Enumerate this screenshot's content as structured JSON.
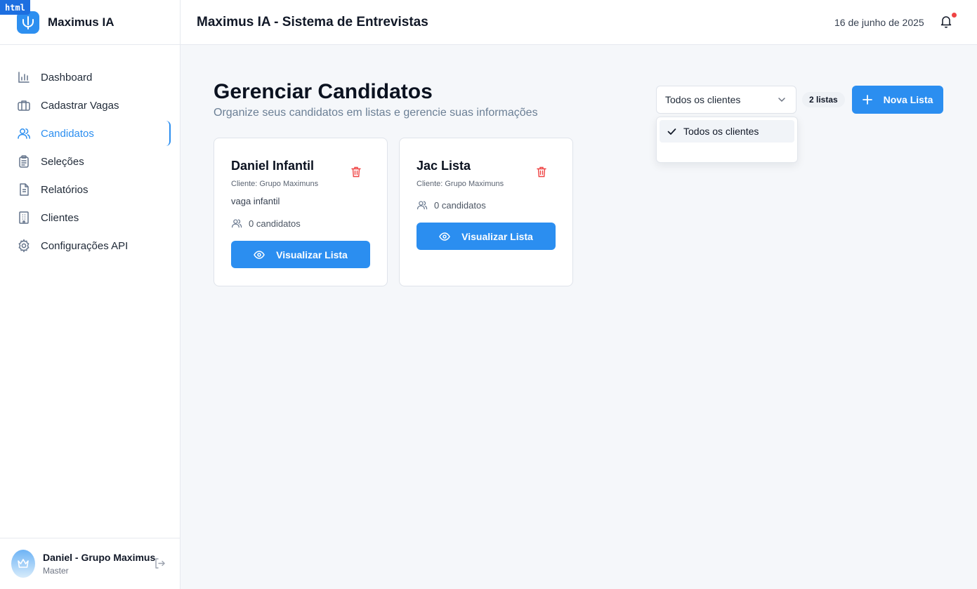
{
  "badge": "html",
  "app": {
    "name": "Maximus IA"
  },
  "sidebar": {
    "items": [
      {
        "label": "Dashboard",
        "icon": "bar-chart-icon"
      },
      {
        "label": "Cadastrar Vagas",
        "icon": "briefcase-icon"
      },
      {
        "label": "Candidatos",
        "icon": "users-icon",
        "active": true
      },
      {
        "label": "Seleções",
        "icon": "clipboard-icon"
      },
      {
        "label": "Relatórios",
        "icon": "file-text-icon"
      },
      {
        "label": "Clientes",
        "icon": "building-icon"
      },
      {
        "label": "Configurações API",
        "icon": "gear-icon"
      }
    ]
  },
  "user": {
    "name": "Daniel - Grupo Maximus",
    "role": "Master"
  },
  "header": {
    "title": "Maximus IA - Sistema de Entrevistas",
    "date": "16 de junho de 2025"
  },
  "page": {
    "title": "Gerenciar Candidatos",
    "subtitle": "Organize seus candidatos em listas e gerencie suas informações"
  },
  "filter": {
    "selected": "Todos os clientes",
    "options": [
      "Todos os clientes"
    ]
  },
  "lists_count": "2 listas",
  "new_list_button": "Nova Lista",
  "cards": [
    {
      "title": "Daniel Infantil",
      "client": "Cliente: Grupo Maximuns",
      "description": "vaga infantil",
      "count": "0 candidatos",
      "button": "Visualizar Lista"
    },
    {
      "title": "Jac Lista",
      "client": "Cliente: Grupo Maximuns",
      "count": "0 candidatos",
      "button": "Visualizar Lista"
    }
  ],
  "colors": {
    "accent": "#2b8ef0",
    "danger": "#ef4444",
    "background": "#f5f7fa"
  }
}
